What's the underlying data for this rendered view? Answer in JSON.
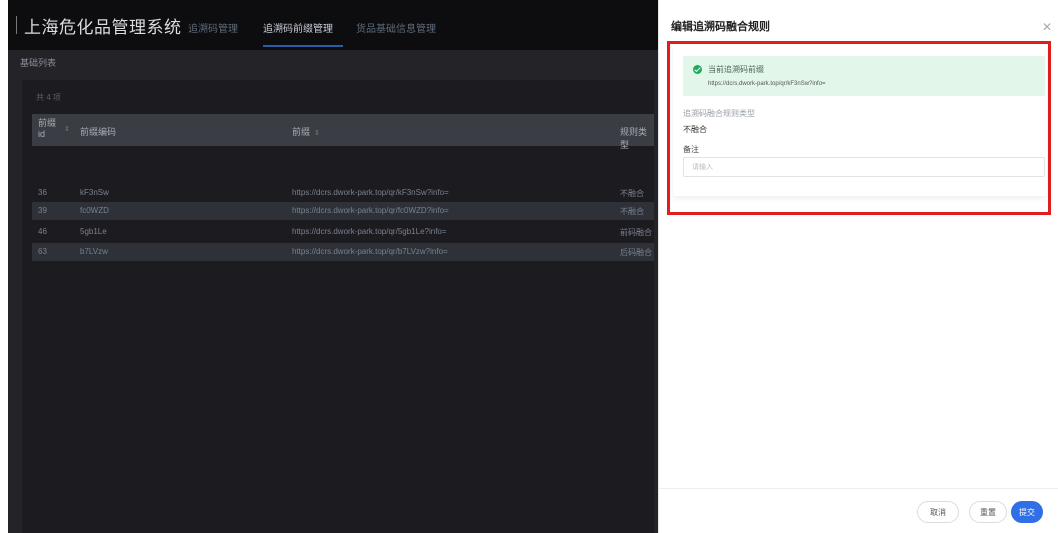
{
  "header": {
    "app_title": "上海危化品管理系统",
    "nav_items": [
      {
        "label": "追溯码管理",
        "active": false
      },
      {
        "label": "追溯码前缀管理",
        "active": true
      },
      {
        "label": "货品基础信息管理",
        "active": false
      }
    ]
  },
  "list": {
    "section_title": "基础列表",
    "total_text": "共 4 项",
    "columns": {
      "prefix_id": "前缀id",
      "prefix_code": "前缀编码",
      "prefix": "前缀",
      "rule_type": "规则类型"
    },
    "rows": [
      {
        "id": "36",
        "code": "kF3nSw",
        "prefix": "https://dcrs.dwork-park.top/qr/kF3nSw?info=",
        "rule": "不融合"
      },
      {
        "id": "39",
        "code": "fc0WZD",
        "prefix": "https://dcrs.dwork-park.top/qr/fc0WZD?info=",
        "rule": "不融合"
      },
      {
        "id": "46",
        "code": "5gb1Le",
        "prefix": "https://dcrs.dwork-park.top/qr/5gb1Le?info=",
        "rule": "前码融合"
      },
      {
        "id": "63",
        "code": "b7LVzw",
        "prefix": "https://dcrs.dwork-park.top/qr/b7LVzw?info=",
        "rule": "后码融合"
      }
    ]
  },
  "drawer": {
    "title": "编辑追溯码融合规则",
    "close_icon": "close-icon",
    "alert": {
      "title": "当前追溯码前缀",
      "url": "https://dcrs.dwork-park.top/qr/kF3nSw?info=",
      "color": "#22a95b"
    },
    "field_type_label": "追溯码融合规则类型",
    "field_type_value": "不融合",
    "remark_label": "备注",
    "remark_placeholder": "请输入",
    "remark_value": "",
    "buttons": {
      "cancel": "取消",
      "reset": "重置",
      "submit": "提交"
    },
    "highlight_color": "#e01e1e",
    "primary_color": "#2f6fe8"
  }
}
